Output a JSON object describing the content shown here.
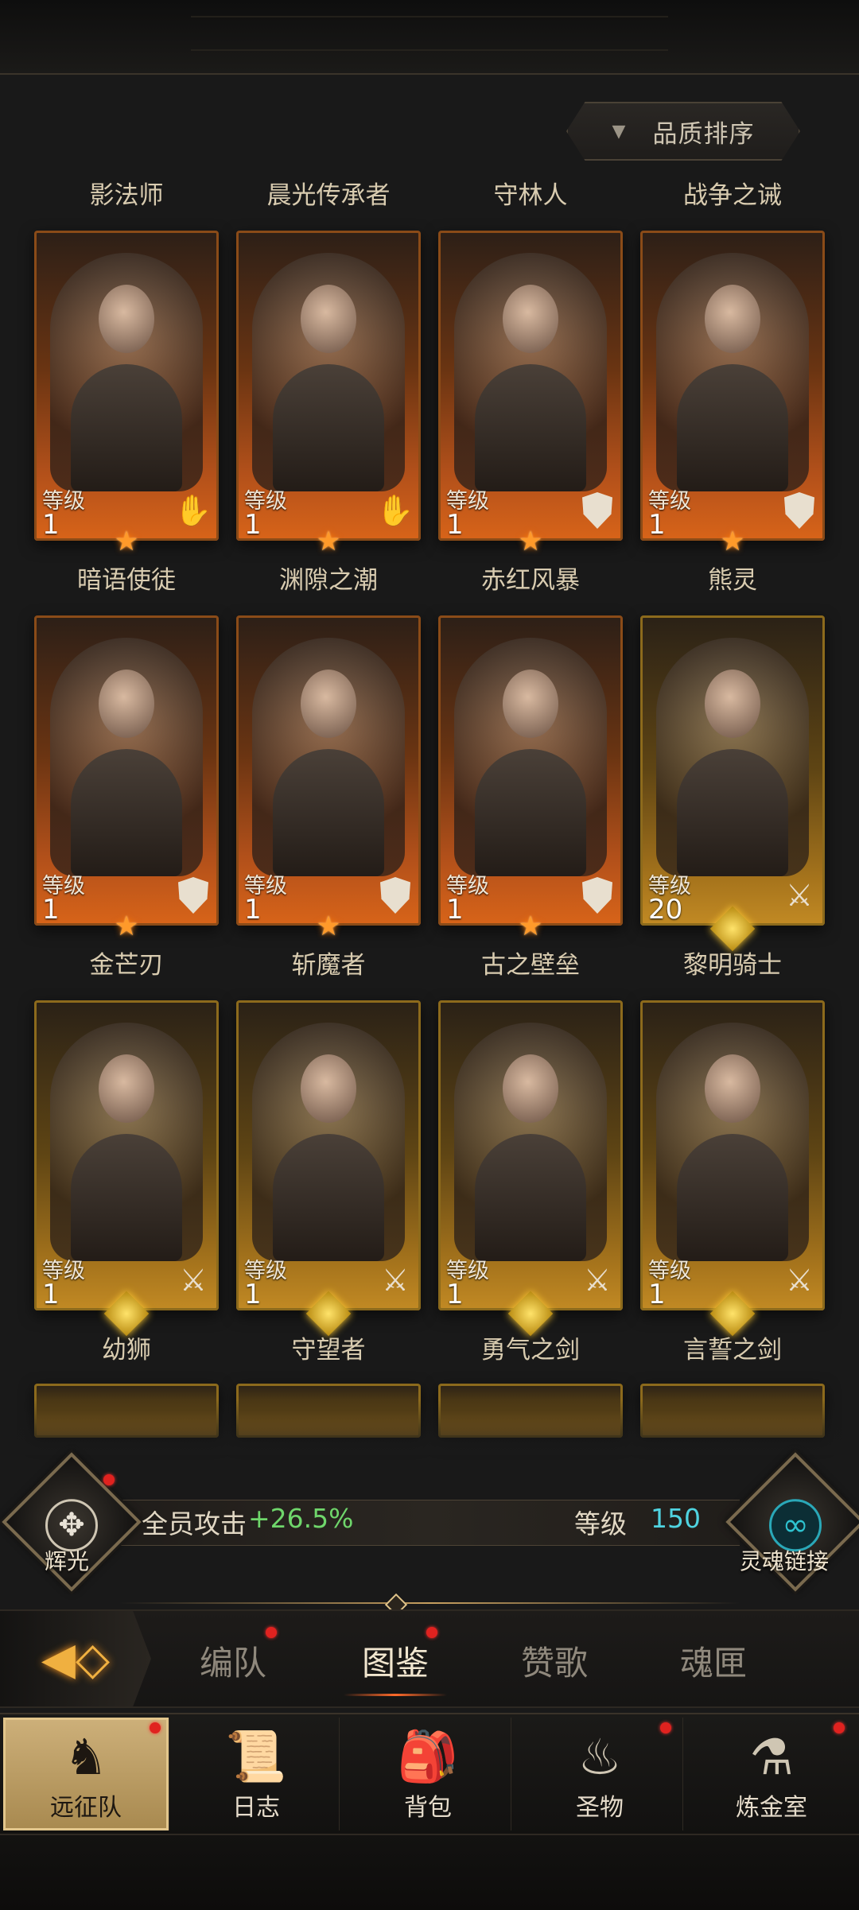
{
  "sort": {
    "label": "品质排序",
    "icon": "dropdown-triangle-icon"
  },
  "level_label": "等级",
  "heroes": [
    {
      "name": "影法师",
      "level": "1",
      "class_icon": "hand-icon",
      "badge": "star",
      "frame": "orange"
    },
    {
      "name": "晨光传承者",
      "level": "1",
      "class_icon": "hand-icon",
      "badge": "star",
      "frame": "orange"
    },
    {
      "name": "守林人",
      "level": "1",
      "class_icon": "shield-icon",
      "badge": "star",
      "frame": "orange"
    },
    {
      "name": "战争之诫",
      "level": "1",
      "class_icon": "shield-icon",
      "badge": "star",
      "frame": "orange"
    },
    {
      "name": "暗语使徒",
      "level": "1",
      "class_icon": "shield-icon",
      "badge": "star",
      "frame": "orange"
    },
    {
      "name": "渊隙之潮",
      "level": "1",
      "class_icon": "shield-icon",
      "badge": "star",
      "frame": "orange"
    },
    {
      "name": "赤红风暴",
      "level": "1",
      "class_icon": "shield-icon",
      "badge": "star",
      "frame": "orange"
    },
    {
      "name": "熊灵",
      "level": "20",
      "class_icon": "sword-icon",
      "badge": "diamond",
      "frame": "gold"
    },
    {
      "name": "金芒刃",
      "level": "1",
      "class_icon": "sword-icon",
      "badge": "diamond",
      "frame": "gold"
    },
    {
      "name": "斩魔者",
      "level": "1",
      "class_icon": "sword-icon",
      "badge": "diamond",
      "frame": "gold"
    },
    {
      "name": "古之壁垒",
      "level": "1",
      "class_icon": "sword-icon",
      "badge": "diamond",
      "frame": "gold"
    },
    {
      "name": "黎明骑士",
      "level": "1",
      "class_icon": "sword-icon",
      "badge": "diamond",
      "frame": "gold"
    }
  ],
  "bottom_names": [
    "幼狮",
    "守望者",
    "勇气之剑",
    "言誓之剑"
  ],
  "stats": {
    "radiance_label": "辉光",
    "attack_label": "全员攻击",
    "attack_value": "+26.5%",
    "level_label": "等级",
    "level_value": "150",
    "soul_link_label": "灵魂链接"
  },
  "sub_tabs": [
    "编队",
    "图鉴",
    "赞歌",
    "魂匣"
  ],
  "active_sub_tab": "图鉴",
  "nav": [
    {
      "label": "远征队",
      "icon": "horned-helmet-icon",
      "active": true
    },
    {
      "label": "日志",
      "icon": "scroll-map-icon",
      "active": false
    },
    {
      "label": "背包",
      "icon": "backpack-icon",
      "active": false
    },
    {
      "label": "圣物",
      "icon": "brazier-icon",
      "active": false
    },
    {
      "label": "炼金室",
      "icon": "alchemy-icon",
      "active": false
    }
  ],
  "colors": {
    "attack_value": "#6fd66b",
    "level_value": "#4fd3e0",
    "notification_dot": "#e0221f",
    "orange_frame": "#d86419",
    "gold_frame": "#c28a24"
  }
}
